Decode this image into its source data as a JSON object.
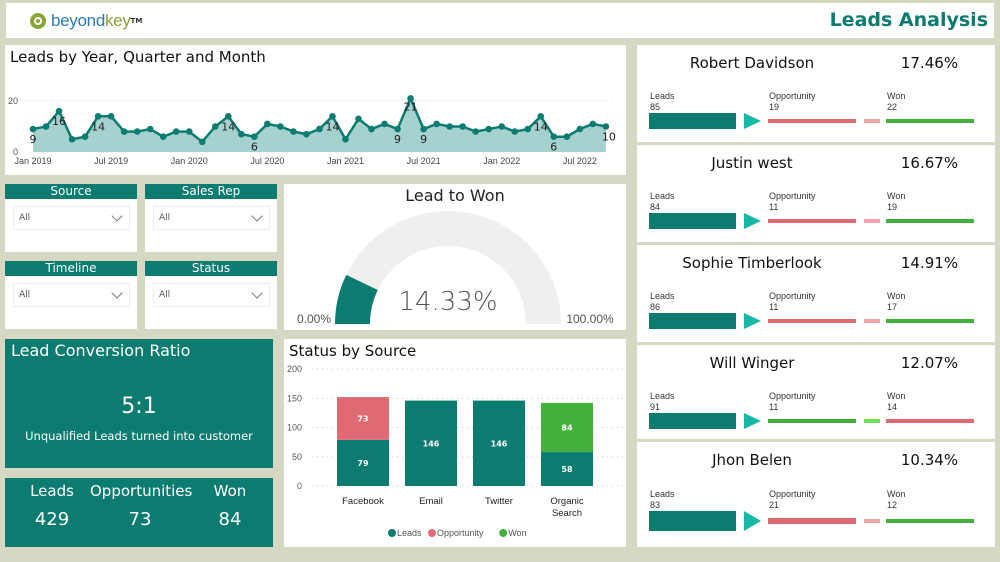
{
  "header": {
    "logo_text_main": "beyond",
    "logo_text_accent": "key",
    "logo_tm": "TM",
    "title": "Leads Analysis"
  },
  "colors": {
    "teal": "#0c7b70",
    "teal_light": "#17b8a6",
    "area_fill": "#a5d2ce",
    "opportunity": "#e06a73",
    "won": "#43b139",
    "background": "#d6d8c4"
  },
  "line_chart": {
    "title": "Leads by Year, Quarter and Month",
    "chart_data": {
      "type": "area",
      "title": "Leads by Year, Quarter and Month",
      "x_start": "Jan 2019",
      "x_end": "Sep 2022",
      "x_ticks": [
        "Jan 2019",
        "Jul 2019",
        "Jan 2020",
        "Jul 2020",
        "Jan 2021",
        "Jul 2021",
        "Jan 2022",
        "Jul 2022"
      ],
      "y_ticks": [
        0,
        20
      ],
      "ylim": [
        0,
        20
      ],
      "grid": true,
      "values": [
        9,
        10,
        16,
        5,
        6,
        14,
        14,
        8,
        8,
        9,
        6,
        8,
        8,
        4,
        10,
        14,
        7,
        6,
        11,
        10,
        8,
        7,
        9,
        14,
        5,
        13,
        9,
        11,
        9,
        21,
        9,
        11,
        10,
        10,
        8,
        9,
        10,
        8,
        9,
        14,
        6,
        6,
        9,
        11,
        10
      ],
      "labeled_points": [
        {
          "index": 0,
          "label": "9",
          "pos": "below"
        },
        {
          "index": 2,
          "label": "16",
          "pos": "below"
        },
        {
          "index": 5,
          "label": "14",
          "pos": "below"
        },
        {
          "index": 15,
          "label": "14",
          "pos": "below"
        },
        {
          "index": 17,
          "label": "6",
          "pos": "below"
        },
        {
          "index": 23,
          "label": "14",
          "pos": "below"
        },
        {
          "index": 28,
          "label": "9",
          "pos": "below"
        },
        {
          "index": 29,
          "label": "21",
          "pos": "below"
        },
        {
          "index": 30,
          "label": "9",
          "pos": "below"
        },
        {
          "index": 39,
          "label": "14",
          "pos": "below"
        },
        {
          "index": 40,
          "label": "6",
          "pos": "below"
        },
        {
          "index": 44,
          "label": "10",
          "pos": "below"
        }
      ]
    }
  },
  "slicers": [
    {
      "title": "Source",
      "value": "All"
    },
    {
      "title": "Sales Rep",
      "value": "All"
    },
    {
      "title": "Timeline",
      "value": "All"
    },
    {
      "title": "Status",
      "value": "All"
    }
  ],
  "gauge": {
    "title": "Lead to Won",
    "value_label": "14.33%",
    "value": 14.33,
    "min_label": "0.00%",
    "max_label": "100.00%",
    "min": 0,
    "max": 100
  },
  "ratio": {
    "title": "Lead Conversion Ratio",
    "value": "5:1",
    "subtitle": "Unqualified Leads turned into customer"
  },
  "totals": [
    {
      "label": "Leads",
      "value": "429"
    },
    {
      "label": "Opportunities",
      "value": "73"
    },
    {
      "label": "Won",
      "value": "84"
    }
  ],
  "bar_chart": {
    "title": "Status by Source",
    "chart_data": {
      "type": "bar",
      "stacked": true,
      "title": "Status by Source",
      "categories": [
        "Facebook",
        "Email",
        "Twitter",
        "Organic Search"
      ],
      "series": [
        {
          "name": "Leads",
          "color": "#0c7b70",
          "values": [
            79,
            146,
            146,
            58
          ]
        },
        {
          "name": "Opportunity",
          "color": "#e06a73",
          "values": [
            73,
            0,
            0,
            0
          ]
        },
        {
          "name": "Won",
          "color": "#43b139",
          "values": [
            0,
            0,
            0,
            84
          ]
        }
      ],
      "y_ticks": [
        0,
        50,
        100,
        150,
        200
      ],
      "ylim": [
        0,
        200
      ],
      "grid": true,
      "legend": "bottom-center"
    }
  },
  "reps": [
    {
      "name": "Robert Davidson",
      "pct": "17.46%",
      "leads_label": "Leads",
      "leads": "85",
      "opp_label": "Opportunity",
      "opp": "19",
      "won_label": "Won",
      "won": "22",
      "mid_color": "#e06a73",
      "dash_color": "#f4a3ab",
      "end_color": "#43b139"
    },
    {
      "name": "Justin west",
      "pct": "16.67%",
      "leads_label": "Leads",
      "leads": "84",
      "opp_label": "Opportunity",
      "opp": "11",
      "won_label": "Won",
      "won": "19",
      "mid_color": "#e06a73",
      "dash_color": "#f4a3ab",
      "end_color": "#43b139"
    },
    {
      "name": "Sophie Timberlook",
      "pct": "14.91%",
      "leads_label": "Leads",
      "leads": "86",
      "opp_label": "Opportunity",
      "opp": "11",
      "won_label": "Won",
      "won": "17",
      "mid_color": "#e06a73",
      "dash_color": "#f4a3ab",
      "end_color": "#43b139"
    },
    {
      "name": "Will Winger",
      "pct": "12.07%",
      "leads_label": "Leads",
      "leads": "91",
      "opp_label": "Opportunity",
      "opp": "11",
      "won_label": "Won",
      "won": "14",
      "mid_color": "#43b139",
      "dash_color": "#6fe05a",
      "end_color": "#e06a73"
    },
    {
      "name": "Jhon Belen",
      "pct": "10.34%",
      "leads_label": "Leads",
      "leads": "83",
      "opp_label": "Opportunity",
      "opp": "21",
      "won_label": "Won",
      "won": "12",
      "mid_color": "#e06a73",
      "dash_color": "#f4a3ab",
      "end_color": "#43b139"
    }
  ]
}
